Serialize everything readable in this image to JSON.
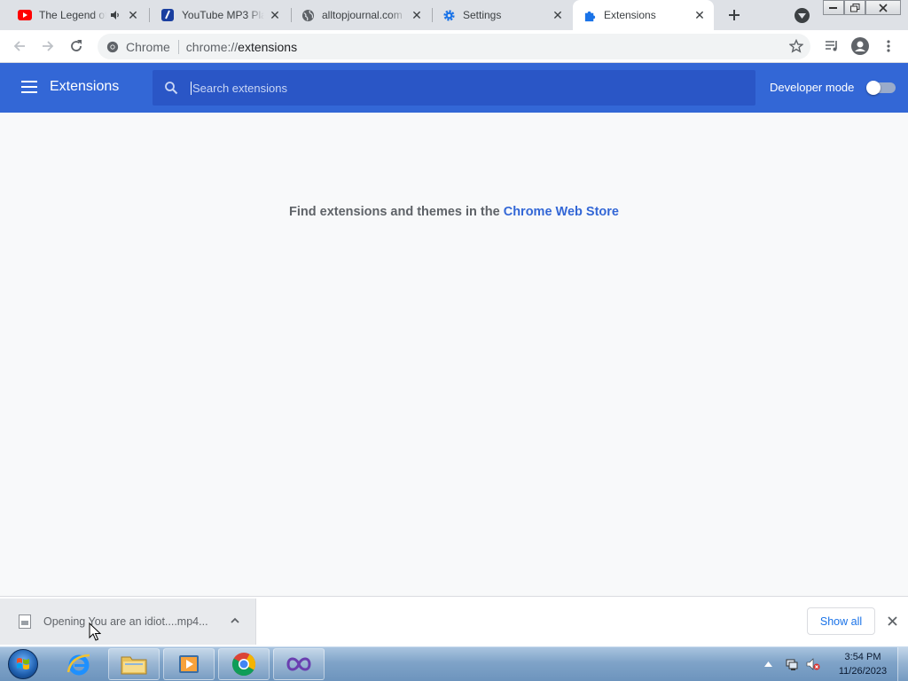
{
  "browser": {
    "tabs": [
      {
        "title": "The Legend of",
        "icon": "youtube-icon",
        "audio": true,
        "active": false
      },
      {
        "title": "YouTube MP3 Pla",
        "icon": "mp3-player-icon",
        "audio": false,
        "active": false
      },
      {
        "title": "alltopjournal.com",
        "icon": "globe-icon",
        "audio": false,
        "active": false
      },
      {
        "title": "Settings",
        "icon": "gear-icon",
        "audio": false,
        "active": false
      },
      {
        "title": "Extensions",
        "icon": "puzzle-icon",
        "active": true
      }
    ],
    "omnibox": {
      "site_chip": "Chrome",
      "url_prefix": "chrome://",
      "url_path": "extensions"
    }
  },
  "extensions_page": {
    "title": "Extensions",
    "search_placeholder": "Search extensions",
    "developer_mode_label": "Developer mode",
    "developer_mode_on": false,
    "empty_text": "Find extensions and themes in the ",
    "empty_link": "Chrome Web Store"
  },
  "download_shelf": {
    "item_text": "Opening You are an idiot....mp4...",
    "show_all_label": "Show all"
  },
  "taskbar": {
    "time": "3:54 PM",
    "date": "11/26/2023",
    "apps": [
      "internet-explorer-icon",
      "file-explorer-icon",
      "media-player-icon",
      "chrome-icon",
      "visual-studio-icon"
    ]
  },
  "colors": {
    "header_blue": "#3367d6",
    "search_blue": "#2a56c6",
    "link_blue": "#3367d6"
  }
}
